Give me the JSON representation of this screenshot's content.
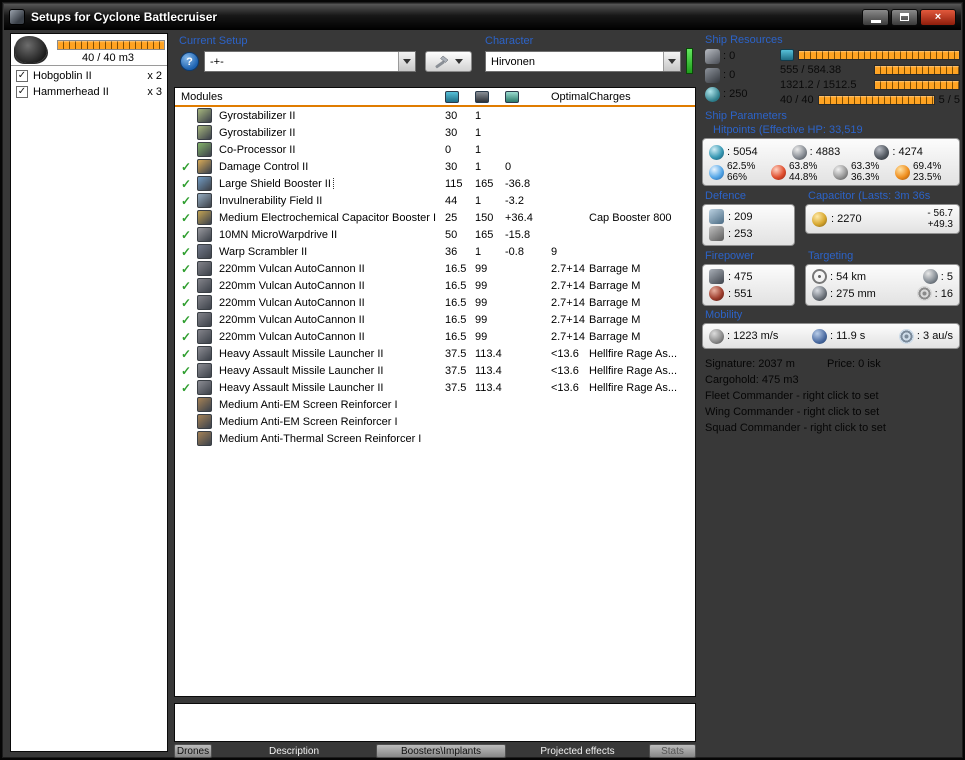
{
  "colors": {
    "accent_blue": "#2c63c8",
    "bar_orange": "#ffa322",
    "check_green": "#2f9e2f",
    "close_red": "#a82512",
    "status_green": "#2fbe2c"
  },
  "window": {
    "title": "Setups for Cyclone Battlecruiser"
  },
  "left_panel": {
    "capacity": "40 / 40 m3",
    "drones": [
      {
        "name": "Hobgoblin II",
        "qty": "x 2",
        "checked": true
      },
      {
        "name": "Hammerhead II",
        "qty": "x 3",
        "checked": true
      }
    ]
  },
  "toolbar": {
    "current_setup_label": "Current Setup",
    "help_label": "?",
    "setup_value": "-+-",
    "character_label": "Character",
    "character_value": "Hirvonen"
  },
  "table": {
    "modules_header": "Modules",
    "optimal_header": "Optimal",
    "charges_header": "Charges",
    "rows": [
      {
        "active": false,
        "selected": false,
        "name": "Gyrostabilizer II",
        "cpu": "30",
        "pg": "1",
        "cap": "",
        "optimal": "",
        "charges": "",
        "icon_color": "#9cab79"
      },
      {
        "active": false,
        "selected": false,
        "name": "Gyrostabilizer II",
        "cpu": "30",
        "pg": "1",
        "cap": "",
        "optimal": "",
        "charges": "",
        "icon_color": "#9cab79"
      },
      {
        "active": false,
        "selected": false,
        "name": "Co-Processor II",
        "cpu": "0",
        "pg": "1",
        "cap": "",
        "optimal": "",
        "charges": "",
        "icon_color": "#7da967"
      },
      {
        "active": true,
        "selected": false,
        "name": "Damage Control II",
        "cpu": "30",
        "pg": "1",
        "cap": "0",
        "optimal": "",
        "charges": "",
        "icon_color": "#c9a056"
      },
      {
        "active": true,
        "selected": true,
        "name": "Large Shield Booster II",
        "cpu": "115",
        "pg": "165",
        "cap": "-36.8",
        "optimal": "",
        "charges": "",
        "icon_color": "#6d92b6"
      },
      {
        "active": true,
        "selected": false,
        "name": "Invulnerability Field II",
        "cpu": "44",
        "pg": "1",
        "cap": "-3.2",
        "optimal": "",
        "charges": "",
        "icon_color": "#8da3b6"
      },
      {
        "active": true,
        "selected": false,
        "name": "Medium Electrochemical Capacitor Booster I",
        "cpu": "25",
        "pg": "150",
        "cap": "+36.4",
        "optimal": "",
        "charges": "Cap Booster 800",
        "icon_color": "#b69a52"
      },
      {
        "active": true,
        "selected": false,
        "name": "10MN MicroWarpdrive II",
        "cpu": "50",
        "pg": "165",
        "cap": "-15.8",
        "optimal": "",
        "charges": "",
        "icon_color": "#8f9096"
      },
      {
        "active": true,
        "selected": false,
        "name": "Warp Scrambler II",
        "cpu": "36",
        "pg": "1",
        "cap": "-0.8",
        "optimal": "9",
        "charges": "",
        "icon_color": "#6e7585"
      },
      {
        "active": true,
        "selected": false,
        "name": "220mm Vulcan AutoCannon II",
        "cpu": "16.5",
        "pg": "99",
        "cap": "",
        "optimal": "2.7+14",
        "charges": "Barrage M",
        "icon_color": "#7c7d84"
      },
      {
        "active": true,
        "selected": false,
        "name": "220mm Vulcan AutoCannon II",
        "cpu": "16.5",
        "pg": "99",
        "cap": "",
        "optimal": "2.7+14",
        "charges": "Barrage M",
        "icon_color": "#7c7d84"
      },
      {
        "active": true,
        "selected": false,
        "name": "220mm Vulcan AutoCannon II",
        "cpu": "16.5",
        "pg": "99",
        "cap": "",
        "optimal": "2.7+14",
        "charges": "Barrage M",
        "icon_color": "#7c7d84"
      },
      {
        "active": true,
        "selected": false,
        "name": "220mm Vulcan AutoCannon II",
        "cpu": "16.5",
        "pg": "99",
        "cap": "",
        "optimal": "2.7+14",
        "charges": "Barrage M",
        "icon_color": "#7c7d84"
      },
      {
        "active": true,
        "selected": false,
        "name": "220mm Vulcan AutoCannon II",
        "cpu": "16.5",
        "pg": "99",
        "cap": "",
        "optimal": "2.7+14",
        "charges": "Barrage M",
        "icon_color": "#7c7d84"
      },
      {
        "active": true,
        "selected": false,
        "name": "Heavy Assault Missile Launcher II",
        "cpu": "37.5",
        "pg": "113.4",
        "cap": "",
        "optimal": "<13.6",
        "charges": "Hellfire Rage As...",
        "icon_color": "#84858c"
      },
      {
        "active": true,
        "selected": false,
        "name": "Heavy Assault Missile Launcher II",
        "cpu": "37.5",
        "pg": "113.4",
        "cap": "",
        "optimal": "<13.6",
        "charges": "Hellfire Rage As...",
        "icon_color": "#84858c"
      },
      {
        "active": true,
        "selected": false,
        "name": "Heavy Assault Missile Launcher II",
        "cpu": "37.5",
        "pg": "113.4",
        "cap": "",
        "optimal": "<13.6",
        "charges": "Hellfire Rage As...",
        "icon_color": "#84858c"
      },
      {
        "active": false,
        "selected": false,
        "name": "Medium Anti-EM Screen Reinforcer I",
        "cpu": "",
        "pg": "",
        "cap": "",
        "optimal": "",
        "charges": "",
        "icon_color": "#9b7c55"
      },
      {
        "active": false,
        "selected": false,
        "name": "Medium Anti-EM Screen Reinforcer I",
        "cpu": "",
        "pg": "",
        "cap": "",
        "optimal": "",
        "charges": "",
        "icon_color": "#9b7c55"
      },
      {
        "active": false,
        "selected": false,
        "name": "Medium Anti-Thermal Screen Reinforcer I",
        "cpu": "",
        "pg": "",
        "cap": "",
        "optimal": "",
        "charges": "",
        "icon_color": "#9b7c55"
      }
    ]
  },
  "tabs": [
    {
      "label": "Drones",
      "style": "chip"
    },
    {
      "label": "Description",
      "style": "flat"
    },
    {
      "label": "Boosters\\Implants",
      "style": "chip"
    },
    {
      "label": "Projected effects",
      "style": "flat"
    },
    {
      "label": "Stats",
      "style": "chip"
    }
  ],
  "ship_resources": {
    "title": "Ship Resources",
    "turrets": ": 0",
    "launchers": ": 0",
    "calibration": ": 250",
    "cpu": "555 / 584.38",
    "powergrid": "1321.2 / 1512.5",
    "dronebay": "40 / 40",
    "drones_active": "5 / 5"
  },
  "ship_parameters": {
    "title": "Ship Parameters",
    "hitpoints_label": "Hitpoints (Effective HP: 33,519",
    "shield_hp": ": 5054",
    "armor_hp": ": 4883",
    "hull_hp": ": 4274",
    "resists": {
      "em": {
        "top": "62.5%",
        "bottom": "66%"
      },
      "thermal": {
        "top": "63.8%",
        "bottom": "44.8%"
      },
      "kinetic": {
        "top": "63.3%",
        "bottom": "36.3%"
      },
      "explosive": {
        "top": "69.4%",
        "bottom": "23.5%"
      }
    },
    "defence_label": "Defence",
    "defence_top": ": 209",
    "defence_bottom": ": 253",
    "capacitor_label": "Capacitor (Lasts: 3m 36s",
    "capacitor_amount": ": 2270",
    "capacitor_delta_out": "- 56.7",
    "capacitor_delta_in": "+49.3",
    "firepower_label": "Firepower",
    "firepower_volley": ": 475",
    "firepower_dps": ": 551",
    "targeting_label": "Targeting",
    "targeting_range": ": 54 km",
    "targeting_max_targets": ": 5",
    "targeting_scan_res": ": 275 mm",
    "targeting_sensor": ": 16",
    "mobility_label": "Mobility",
    "mobility_speed": ": 1223 m/s",
    "mobility_align": ": 11.9 s",
    "mobility_warp": ": 3 au/s",
    "signature": "Signature: 2037 m",
    "price": "Price: 0 isk",
    "cargohold": "Cargohold: 475 m3",
    "commanders": [
      "Fleet Commander - right click to set",
      "Wing Commander - right click to set",
      "Squad Commander - right click to set"
    ]
  },
  "icons": {
    "check": "✓"
  }
}
